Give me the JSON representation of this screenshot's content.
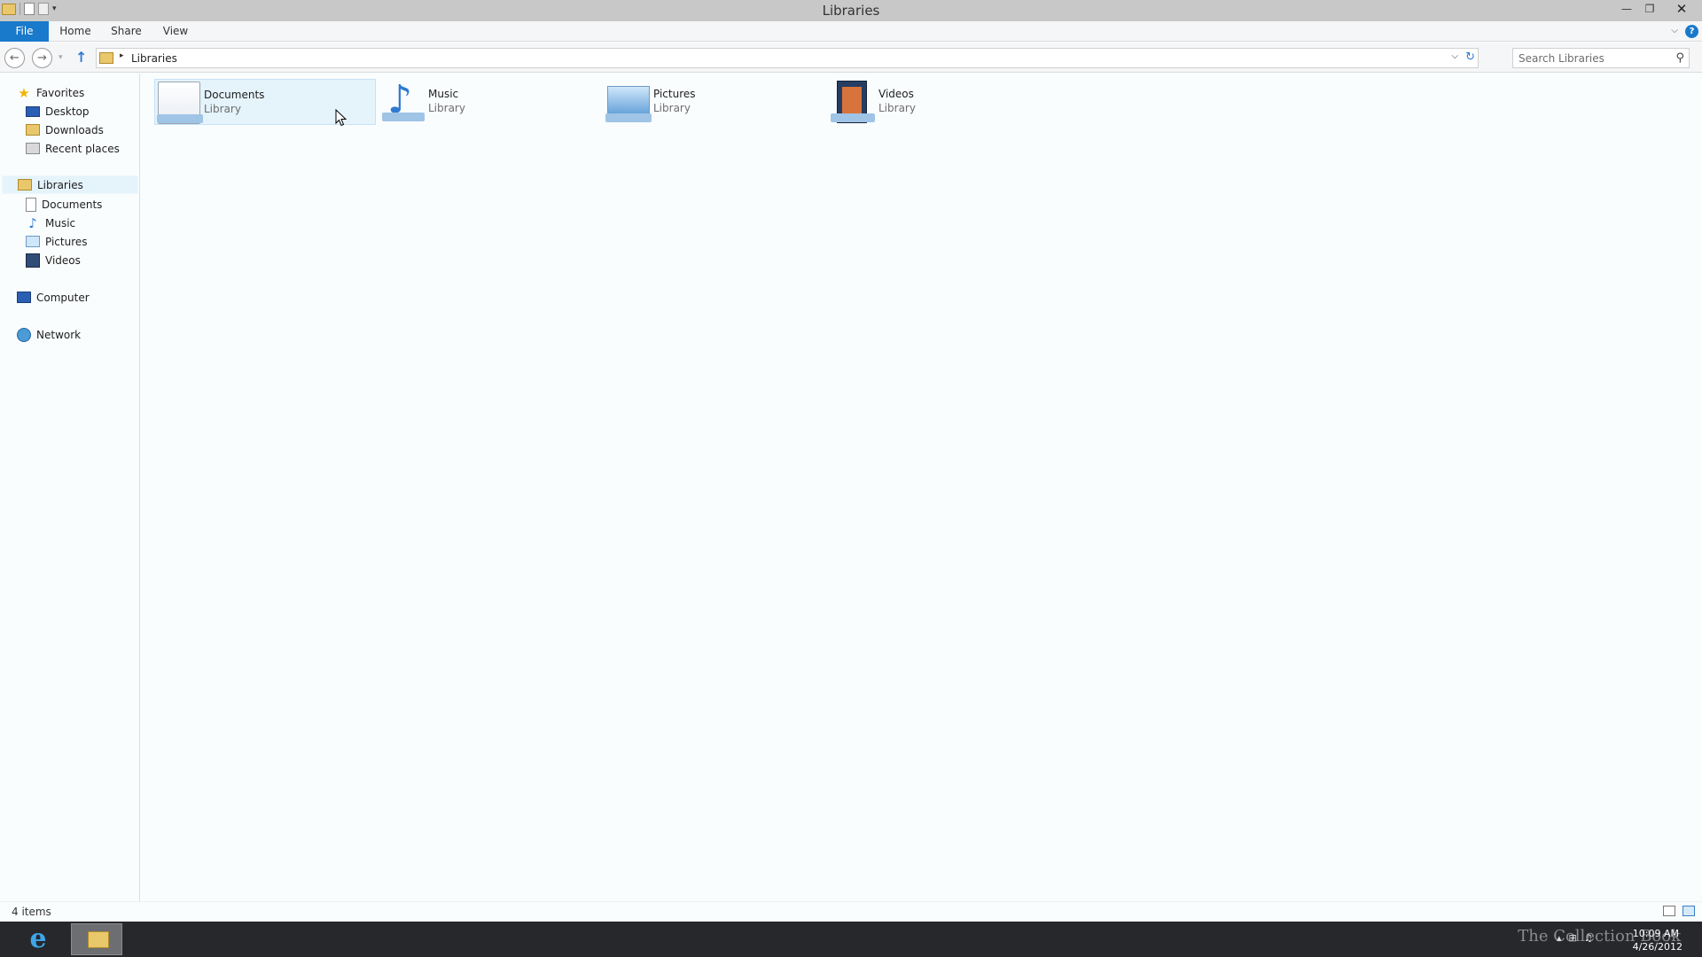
{
  "window": {
    "title": "Libraries",
    "controls": {
      "minimize": "—",
      "maximize": "❐",
      "close": "✕"
    }
  },
  "ribbon": {
    "tabs": [
      {
        "label": "File"
      },
      {
        "label": "Home"
      },
      {
        "label": "Share"
      },
      {
        "label": "View"
      }
    ],
    "help": "?"
  },
  "address": {
    "breadcrumb": [
      "Libraries"
    ],
    "search_placeholder": "Search Libraries"
  },
  "nav_pane": {
    "favorites": {
      "label": "Favorites",
      "items": [
        {
          "label": "Desktop",
          "icon": "desktop-icon"
        },
        {
          "label": "Downloads",
          "icon": "downloads-icon"
        },
        {
          "label": "Recent places",
          "icon": "recent-places-icon"
        }
      ]
    },
    "libraries": {
      "label": "Libraries",
      "items": [
        {
          "label": "Documents",
          "icon": "documents-icon"
        },
        {
          "label": "Music",
          "icon": "music-icon"
        },
        {
          "label": "Pictures",
          "icon": "pictures-icon"
        },
        {
          "label": "Videos",
          "icon": "videos-icon"
        }
      ]
    },
    "computer": {
      "label": "Computer"
    },
    "network": {
      "label": "Network"
    }
  },
  "content": {
    "items": [
      {
        "name": "Documents",
        "type": "Library",
        "icon": "documents-library-icon",
        "selected": true
      },
      {
        "name": "Music",
        "type": "Library",
        "icon": "music-library-icon",
        "selected": false
      },
      {
        "name": "Pictures",
        "type": "Library",
        "icon": "pictures-library-icon",
        "selected": false
      },
      {
        "name": "Videos",
        "type": "Library",
        "icon": "videos-library-icon",
        "selected": false
      }
    ]
  },
  "status": {
    "item_count": "4 items"
  },
  "taskbar": {
    "time": "10:09 AM",
    "date": "4/26/2012",
    "watermark": "The Collection Book"
  },
  "colors": {
    "accent": "#1979ca",
    "selection": "#e5f3fb",
    "taskbar": "#26282c"
  }
}
